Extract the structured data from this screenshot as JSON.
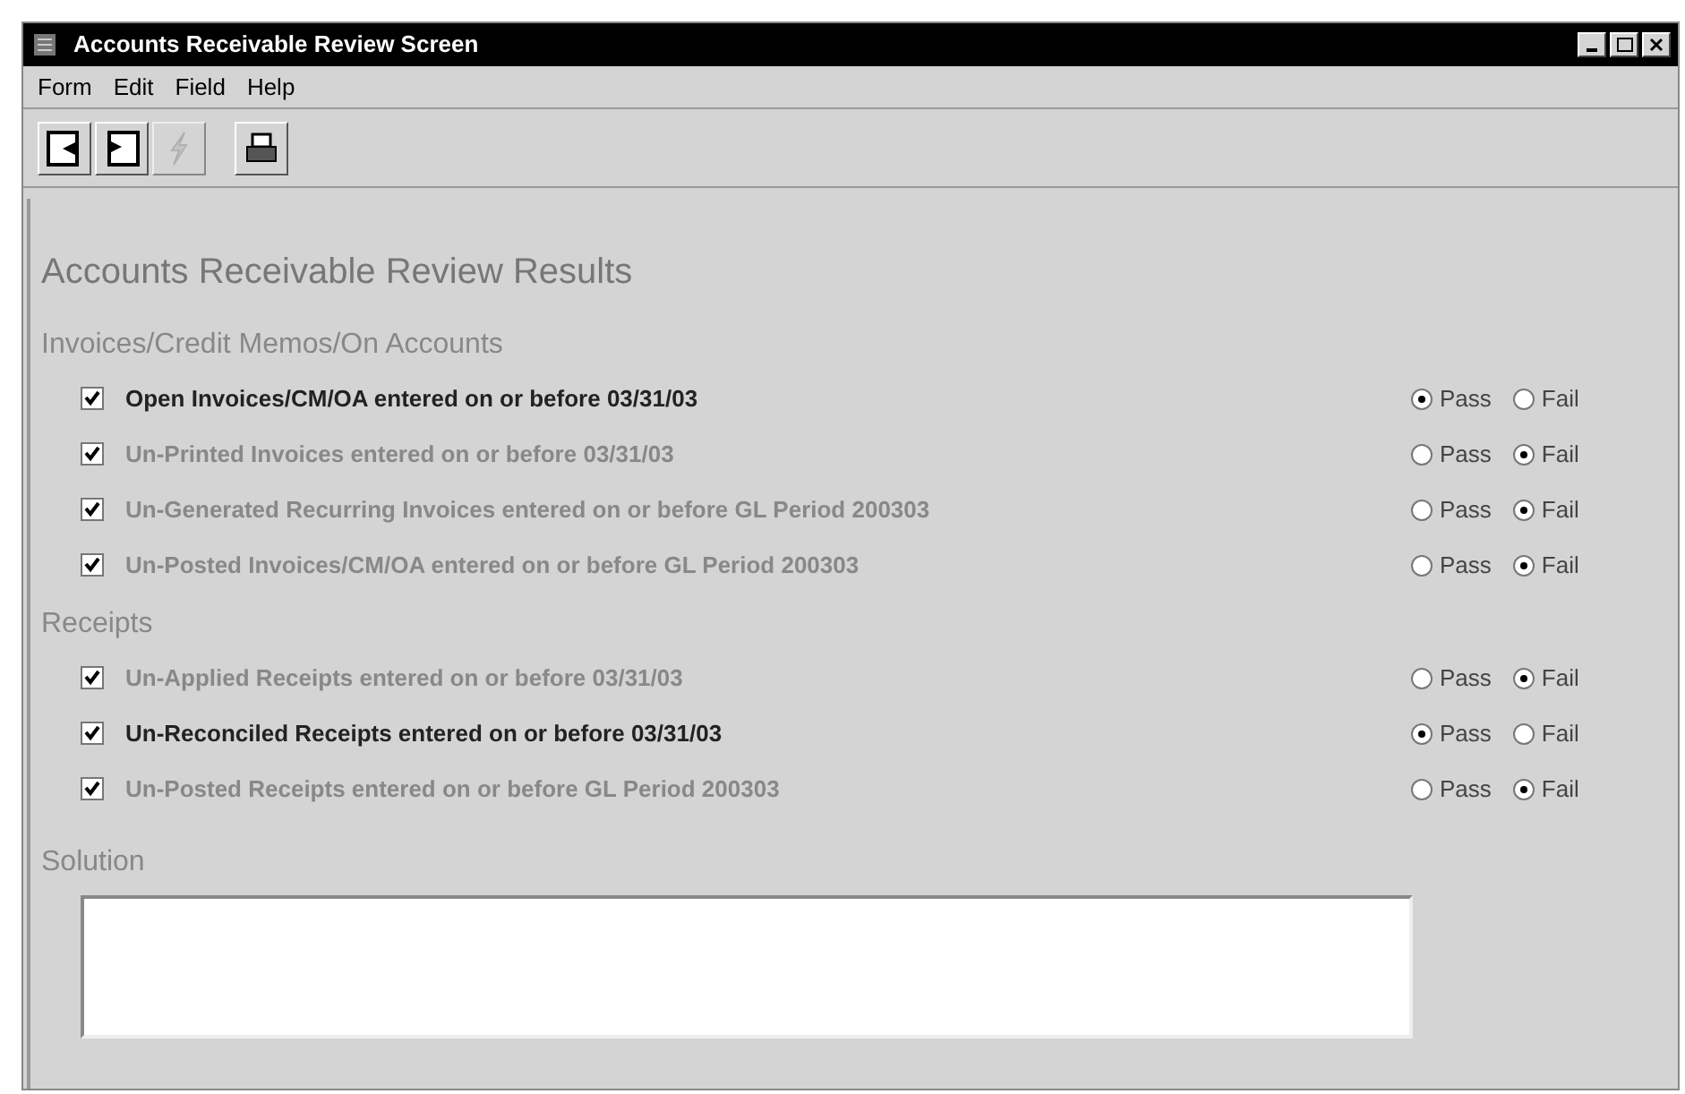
{
  "window": {
    "title": "Accounts Receivable Review Screen"
  },
  "menu": [
    "Form",
    "Edit",
    "Field",
    "Help"
  ],
  "toolbar": [
    {
      "kind": "open",
      "disabled": false
    },
    {
      "kind": "back",
      "disabled": false
    },
    {
      "kind": "run",
      "disabled": true
    },
    {
      "kind": "print",
      "disabled": false
    }
  ],
  "heading": "Accounts Receivable Review Results",
  "sections": [
    {
      "title": "Invoices/Credit Memos/On Accounts",
      "items": [
        {
          "label": "Open Invoices/CM/OA entered on or before 03/31/03",
          "checked": true,
          "highlighted": true,
          "options": [
            {
              "label": "Pass",
              "selected": true
            },
            {
              "label": "Fail",
              "selected": false
            }
          ]
        },
        {
          "label": "Un-Printed Invoices entered on or before 03/31/03",
          "checked": true,
          "highlighted": false,
          "options": [
            {
              "label": "Pass",
              "selected": false
            },
            {
              "label": "Fail",
              "selected": true
            }
          ]
        },
        {
          "label": "Un-Generated Recurring Invoices entered on or before GL Period 200303",
          "checked": true,
          "highlighted": false,
          "options": [
            {
              "label": "Pass",
              "selected": false
            },
            {
              "label": "Fail",
              "selected": true
            }
          ]
        },
        {
          "label": "Un-Posted Invoices/CM/OA entered on or before GL Period 200303",
          "checked": true,
          "highlighted": false,
          "options": [
            {
              "label": "Pass",
              "selected": false
            },
            {
              "label": "Fail",
              "selected": true
            }
          ]
        }
      ]
    },
    {
      "title": "Receipts",
      "items": [
        {
          "label": "Un-Applied Receipts entered on or before 03/31/03",
          "checked": true,
          "highlighted": false,
          "options": [
            {
              "label": "Pass",
              "selected": false
            },
            {
              "label": "Fail",
              "selected": true
            }
          ]
        },
        {
          "label": "Un-Reconciled Receipts entered on or before 03/31/03",
          "checked": true,
          "highlighted": true,
          "options": [
            {
              "label": "Pass",
              "selected": true
            },
            {
              "label": "Fail",
              "selected": false
            }
          ]
        },
        {
          "label": "Un-Posted Receipts entered on or before GL Period 200303",
          "checked": true,
          "highlighted": false,
          "options": [
            {
              "label": "Pass",
              "selected": false
            },
            {
              "label": "Fail",
              "selected": true
            }
          ]
        }
      ]
    }
  ],
  "solution": {
    "label": "Solution"
  }
}
